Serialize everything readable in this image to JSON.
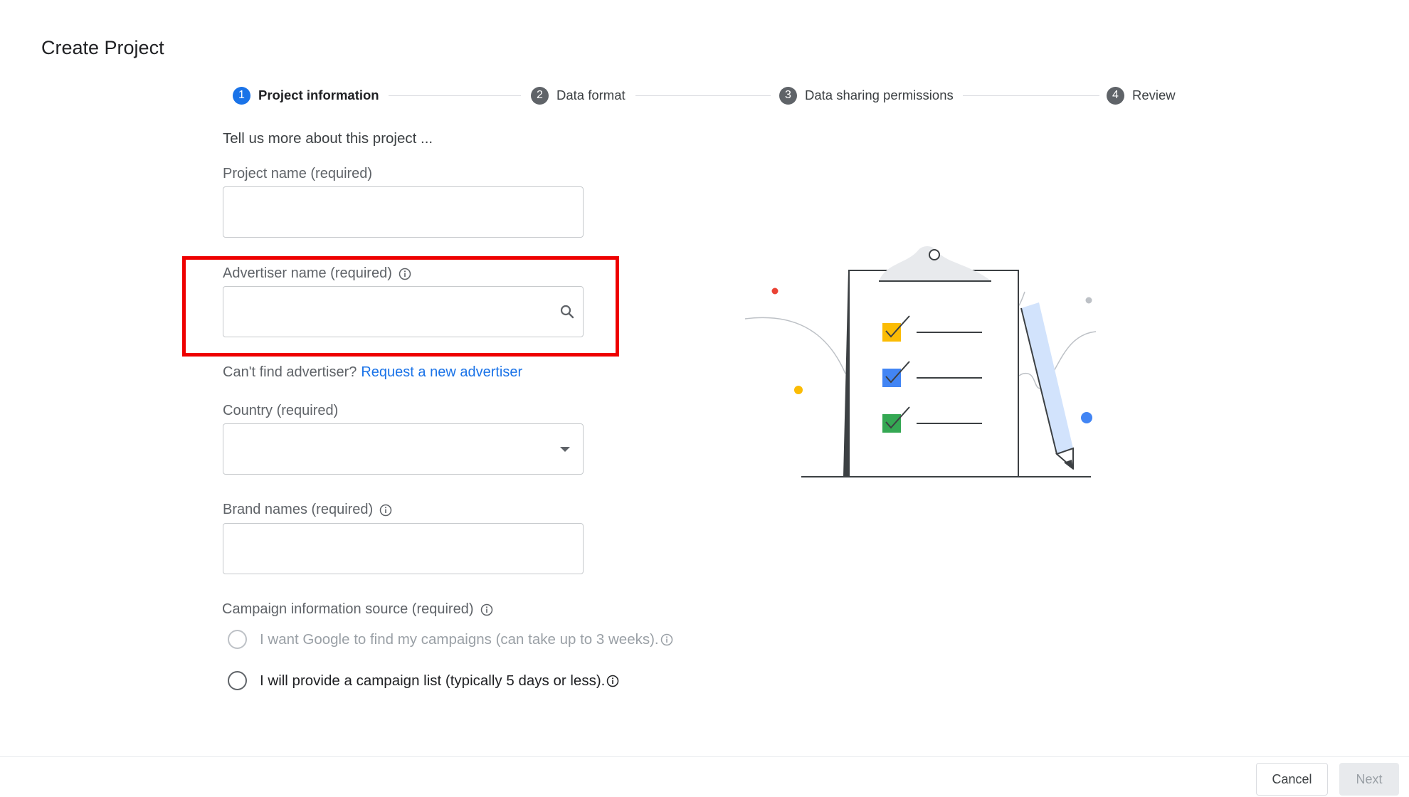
{
  "page": {
    "title": "Create Project"
  },
  "stepper": {
    "steps": [
      {
        "number": "1",
        "label": "Project information",
        "active": true
      },
      {
        "number": "2",
        "label": "Data format",
        "active": false
      },
      {
        "number": "3",
        "label": "Data sharing permissions",
        "active": false
      },
      {
        "number": "4",
        "label": "Review",
        "active": false
      }
    ]
  },
  "form": {
    "intro": "Tell us more about this project ...",
    "project_name": {
      "label": "Project name (required)",
      "value": ""
    },
    "advertiser_name": {
      "label": "Advertiser name (required)",
      "value": "",
      "icon": "search-icon"
    },
    "advertiser_helper": {
      "text": "Can't find advertiser?",
      "link": "Request a new advertiser"
    },
    "country": {
      "label": "Country (required)",
      "value": ""
    },
    "brand_names": {
      "label": "Brand names (required)",
      "value": ""
    },
    "campaign_source": {
      "label": "Campaign information source (required)",
      "options": [
        {
          "label": "I want Google to find my campaigns (can take up to 3 weeks).",
          "disabled": true,
          "selected": false
        },
        {
          "label": "I will provide a campaign list (typically 5 days or less).",
          "disabled": false,
          "selected": false
        }
      ]
    }
  },
  "highlight": {
    "color": "#ee0000",
    "target": "advertiser-name-field"
  },
  "colors": {
    "accent": "#1a73e8",
    "yellow": "#fbbc04",
    "blue": "#4285f4",
    "green": "#34a853",
    "red": "#ea4335"
  },
  "footer": {
    "cancel_label": "Cancel",
    "next_label": "Next",
    "next_disabled": true
  }
}
